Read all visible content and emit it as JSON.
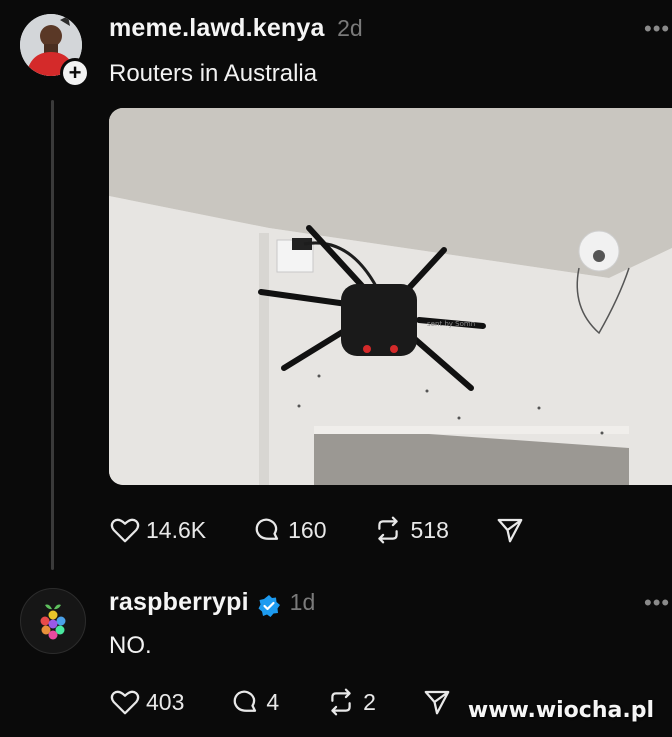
{
  "post1": {
    "username": "meme.lawd.kenya",
    "time": "2d",
    "text": "Routers in Australia",
    "photo_watermark": "sent by Somn",
    "likes": "14.6K",
    "comments": "160",
    "reposts": "518"
  },
  "post2": {
    "username": "raspberrypi",
    "time": "1d",
    "text": "NO.",
    "likes": "403",
    "comments": "4",
    "reposts": "2"
  },
  "watermark": "www.wiocha.pl",
  "colors": {
    "background": "#0a0a0a",
    "verified": "#1d9bf0",
    "timestamp": "#7a7a7a"
  },
  "icons": [
    "heart-icon",
    "comment-icon",
    "repost-icon",
    "share-icon",
    "more-icon",
    "plus-icon",
    "verified-icon"
  ]
}
